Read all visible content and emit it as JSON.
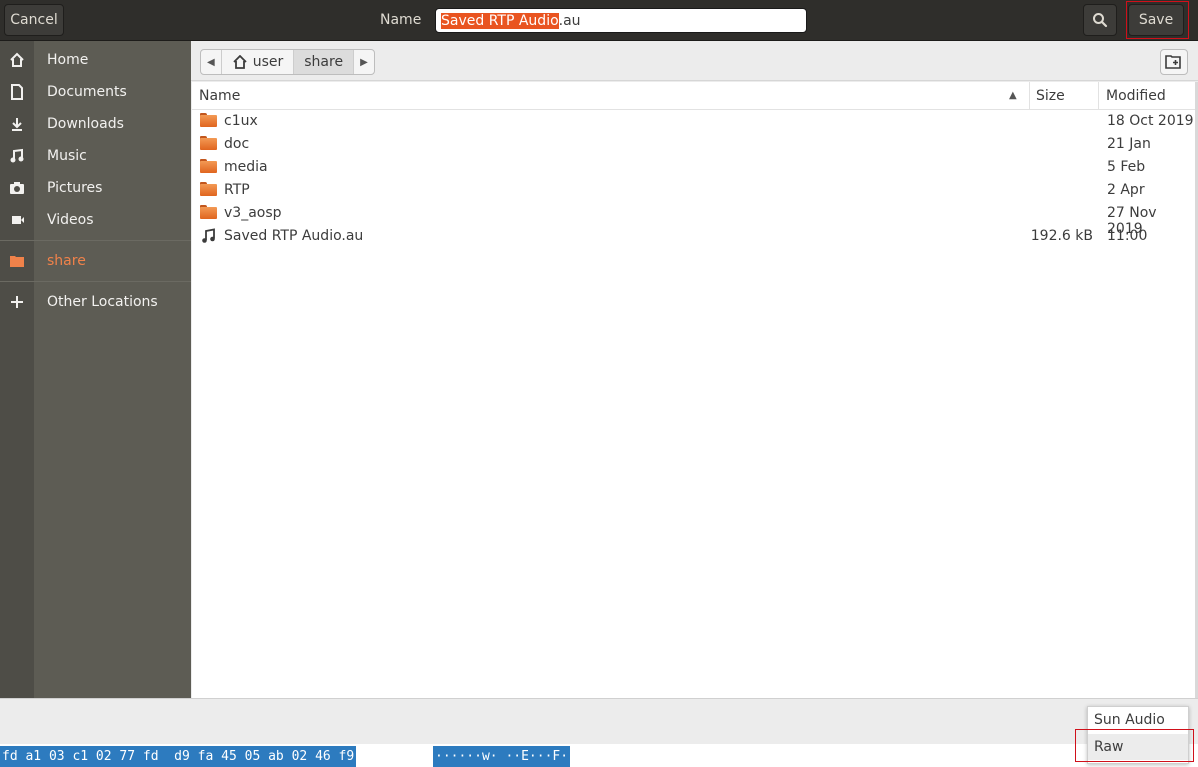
{
  "header": {
    "cancel_label": "Cancel",
    "name_label": "Name",
    "filename_selected": "Saved RTP Audio",
    "filename_ext": ".au",
    "search_icon": "search-icon",
    "save_label": "Save"
  },
  "sidebar": {
    "items": [
      {
        "label": "Home",
        "icon": "home-icon"
      },
      {
        "label": "Documents",
        "icon": "document-icon"
      },
      {
        "label": "Downloads",
        "icon": "download-icon"
      },
      {
        "label": "Music",
        "icon": "music-icon"
      },
      {
        "label": "Pictures",
        "icon": "camera-icon"
      },
      {
        "label": "Videos",
        "icon": "video-icon"
      },
      {
        "label": "share",
        "icon": "folder-icon",
        "active": true
      },
      {
        "label": "Other Locations",
        "icon": "plus-icon"
      }
    ],
    "active_color": "#f0824a"
  },
  "pathbar": {
    "crumbs": [
      "user",
      "share"
    ],
    "home_icon": "home-icon",
    "new_folder_icon": "new-folder-icon"
  },
  "filelist": {
    "columns": {
      "name": "Name",
      "size": "Size",
      "modified": "Modified"
    },
    "rows": [
      {
        "name": "c1ux",
        "size": "",
        "modified": "18 Oct 2019",
        "type": "folder"
      },
      {
        "name": "doc",
        "size": "",
        "modified": "21 Jan",
        "type": "folder"
      },
      {
        "name": "media",
        "size": "",
        "modified": "5 Feb",
        "type": "folder"
      },
      {
        "name": "RTP",
        "size": "",
        "modified": "2 Apr",
        "type": "folder"
      },
      {
        "name": "v3_aosp",
        "size": "",
        "modified": "27 Nov 2019",
        "type": "folder"
      },
      {
        "name": "Saved RTP Audio.au",
        "size": "192.6 kB",
        "modified": "11:00",
        "type": "audio"
      }
    ]
  },
  "format_popup": {
    "options": [
      "Sun Audio",
      "Raw"
    ],
    "highlighted": "Raw"
  },
  "hex_strip": {
    "bytes": "fd a1 03 c1 02 77 fd  d9 fa 45 05 ab 02 46 f9",
    "ascii": "······w· ··E···F·"
  },
  "colors": {
    "headerbar": "#2f2e2b",
    "sidebar": "#5d5c54",
    "selection": "#e95420",
    "highlight_box": "#d0101a"
  }
}
